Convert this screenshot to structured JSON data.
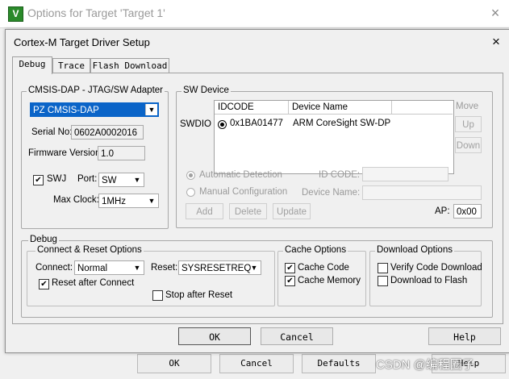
{
  "outer": {
    "title": "Options for Target 'Target 1'",
    "logo": "V",
    "close_icon": "×",
    "ok": "OK",
    "cancel": "Cancel",
    "defaults": "Defaults",
    "help": "Help"
  },
  "dialog": {
    "title": "Cortex-M Target Driver Setup",
    "close_icon": "×"
  },
  "tabs": [
    "Debug",
    "Trace",
    "Flash Download"
  ],
  "adapter": {
    "group_title": "CMSIS-DAP - JTAG/SW Adapter",
    "selected": "PZ CMSIS-DAP",
    "serial_label": "Serial No:",
    "serial_value": "0602A0002016",
    "firmware_label": "Firmware Version:",
    "firmware_value": "1.0",
    "swj_label": "SWJ",
    "swj_checked": true,
    "port_label": "Port:",
    "port_value": "SW",
    "maxclock_label": "Max Clock:",
    "maxclock_value": "1MHz"
  },
  "sw_device": {
    "group_title": "SW Device",
    "swdio_label": "SWDIO",
    "columns": [
      "IDCODE",
      "Device Name"
    ],
    "rows": [
      {
        "idcode": "0x1BA01477",
        "name": "ARM CoreSight SW-DP",
        "selected": true
      }
    ],
    "move_label": "Move",
    "up": "Up",
    "down": "Down",
    "auto_detect": "Automatic Detection",
    "manual_config": "Manual Configuration",
    "id_code_label": "ID CODE:",
    "device_name_label": "Device Name:",
    "add": "Add",
    "delete": "Delete",
    "update": "Update",
    "ap_label": "AP:",
    "ap_value": "0x00"
  },
  "debug": {
    "group_title": "Debug",
    "connect_reset": {
      "title": "Connect & Reset Options",
      "connect_label": "Connect:",
      "connect_value": "Normal",
      "reset_label": "Reset:",
      "reset_value": "SYSRESETREQ",
      "reset_after_connect": "Reset after Connect",
      "reset_after_connect_checked": true,
      "stop_after_reset": "Stop after Reset",
      "stop_after_reset_checked": false
    },
    "cache": {
      "title": "Cache Options",
      "cache_code": "Cache Code",
      "cache_code_checked": true,
      "cache_memory": "Cache Memory",
      "cache_memory_checked": true
    },
    "download": {
      "title": "Download Options",
      "verify": "Verify Code Download",
      "verify_checked": false,
      "download_flash": "Download to Flash",
      "download_flash_checked": false
    }
  },
  "buttons": {
    "ok": "OK",
    "cancel": "Cancel",
    "help": "Help"
  },
  "watermark": "CSDN @编程圈子",
  "check_mark": "✔",
  "combo_arrow": "▼",
  "colors": {
    "selection": "#0a64c8",
    "logo_green": "#2a8a2a"
  }
}
